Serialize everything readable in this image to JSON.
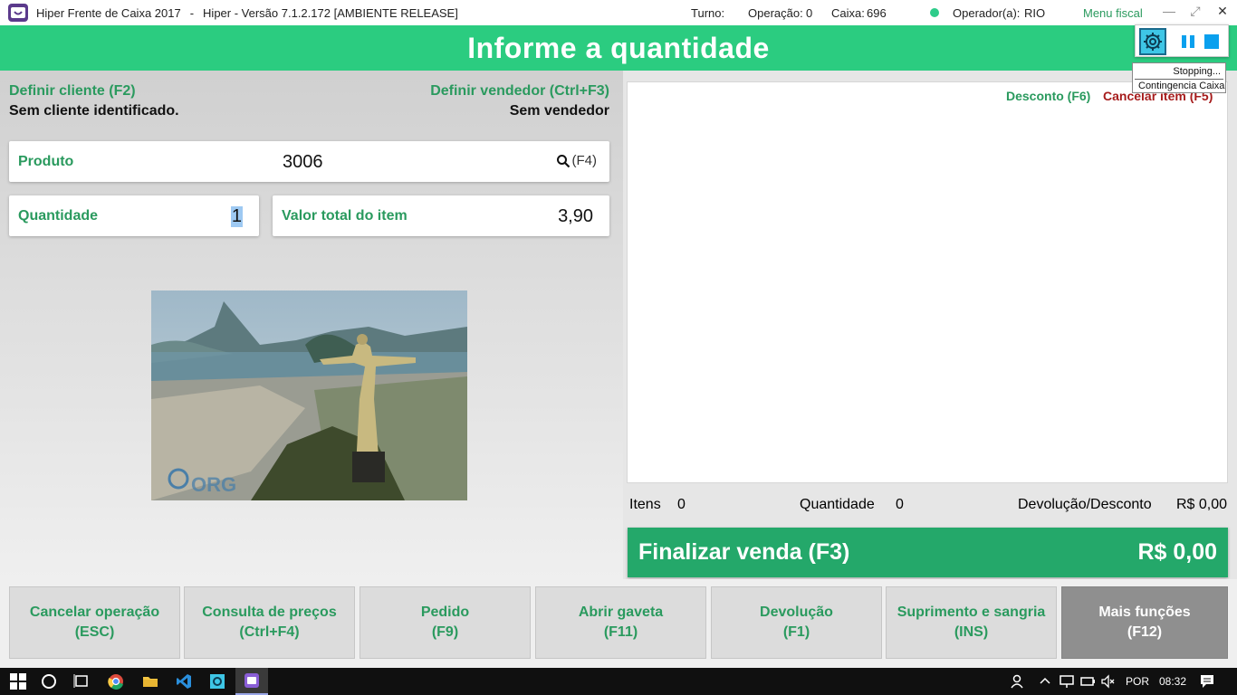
{
  "window": {
    "app_title": "Hiper Frente de Caixa 2017",
    "separator": "-",
    "version": "Hiper - Versão 7.1.2.172 [AMBIENTE RELEASE]",
    "turno_label": "Turno:",
    "operacao_label": "Operação:",
    "operacao_value": "0",
    "caixa_label": "Caixa:",
    "caixa_value": "696",
    "operador_label": "Operador(a):",
    "operador_value": "RIO",
    "menu_fiscal": "Menu fiscal",
    "minimize": "—",
    "restore": "⤢",
    "close": "✕"
  },
  "header": {
    "title": "Informe a quantidade"
  },
  "customer": {
    "link": "Definir cliente (F2)",
    "value": "Sem cliente identificado."
  },
  "seller": {
    "link": "Definir vendedor (Ctrl+F3)",
    "value": "Sem vendedor"
  },
  "product": {
    "label": "Produto",
    "value": "3006",
    "search_hint": "(F4)"
  },
  "quantity": {
    "label": "Quantidade",
    "value": "1"
  },
  "item_total": {
    "label": "Valor total do item",
    "value": "3,90"
  },
  "items_panel": {
    "discount_link": "Desconto (F6)",
    "cancel_item_link": "Cancelar item (F5)"
  },
  "summary": {
    "itens_label": "Itens",
    "itens_value": "0",
    "quantidade_label": "Quantidade",
    "quantidade_value": "0",
    "devolucao_label": "Devolução/Desconto",
    "devolucao_value": "R$ 0,00"
  },
  "finalize": {
    "label": "Finalizar venda (F3)",
    "total": "R$ 0,00"
  },
  "function_buttons": [
    {
      "name": "Cancelar operação",
      "key": "(ESC)"
    },
    {
      "name": "Consulta de preços",
      "key": "(Ctrl+F4)"
    },
    {
      "name": "Pedido",
      "key": "(F9)"
    },
    {
      "name": "Abrir gaveta",
      "key": "(F11)"
    },
    {
      "name": "Devolução",
      "key": "(F1)"
    },
    {
      "name": "Suprimento e sangria",
      "key": "(INS)"
    },
    {
      "name": "Mais funções",
      "key": "(F12)"
    }
  ],
  "overlay": {
    "status": "Stopping...",
    "tooltip": "Contingencia Caixa"
  },
  "taskbar": {
    "language": "POR",
    "time": "08:32"
  },
  "colors": {
    "accent_green": "#2bcc80",
    "label_green": "#2a9a5e",
    "finalize_green": "#24a86a",
    "cancel_red": "#a61c1c"
  }
}
